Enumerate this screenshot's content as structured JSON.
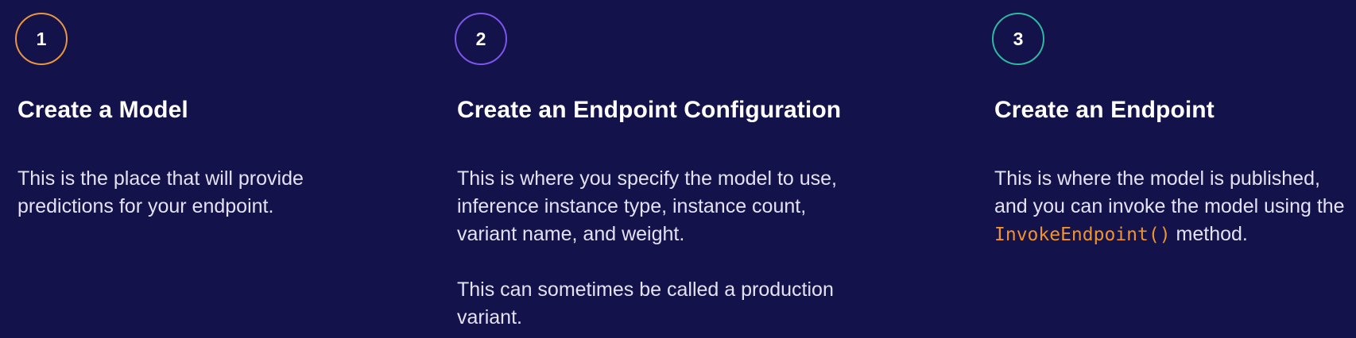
{
  "steps": [
    {
      "number": "1",
      "title": "Create a Model",
      "description": [
        "This is the place that will provide predictions for your endpoint."
      ],
      "badge_color": "#e8963f"
    },
    {
      "number": "2",
      "title": "Create an Endpoint Configuration",
      "description": [
        "This is where you specify the model to use, inference instance type, instance count, variant name, and weight.",
        "This can sometimes be called a production variant."
      ],
      "badge_color": "#7c55ea"
    },
    {
      "number": "3",
      "title": "Create an Endpoint",
      "description_before_code": "This is where the model is published, and you can invoke the model using the",
      "code": "InvokeEndpoint()",
      "description_after_code": "method.",
      "badge_color": "#2fb8a0"
    }
  ],
  "colors": {
    "background": "#14124a",
    "text": "#ffffff",
    "code": "#f0932e"
  }
}
